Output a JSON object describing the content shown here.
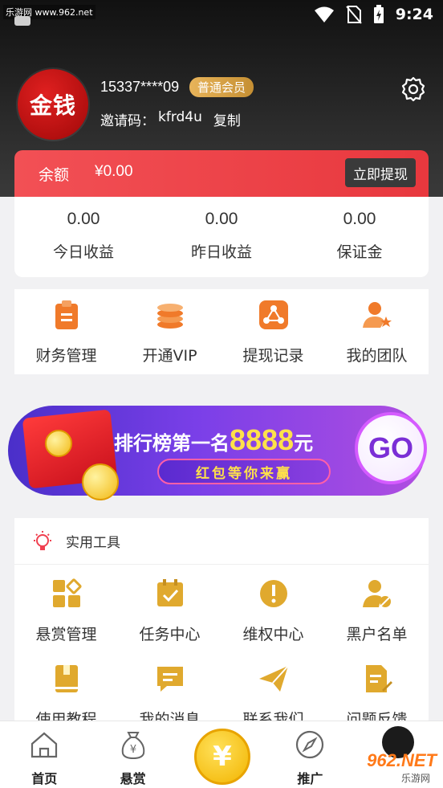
{
  "statusbar": {
    "watermark": "乐游网 www.962.net",
    "time": "9:24"
  },
  "profile": {
    "avatar_text": "金钱",
    "phone": "15337****09",
    "member_level": "普通会员",
    "invite_label": "邀请码：",
    "invite_code": "kfrd4u",
    "copy_label": "复制"
  },
  "balance": {
    "label": "余额",
    "value": "¥0.00",
    "withdraw_label": "立即提现"
  },
  "earnings": [
    {
      "value": "0.00",
      "label": "今日收益"
    },
    {
      "value": "0.00",
      "label": "昨日收益"
    },
    {
      "value": "0.00",
      "label": "保证金"
    }
  ],
  "quick_menu": [
    {
      "label": "财务管理",
      "icon": "clipboard-icon"
    },
    {
      "label": "开通VIP",
      "icon": "coins-icon"
    },
    {
      "label": "提现记录",
      "icon": "share-icon"
    },
    {
      "label": "我的团队",
      "icon": "user-star-icon"
    }
  ],
  "banner": {
    "title": "排行榜第一名",
    "amount": "8888",
    "unit": "元",
    "subtitle": "红包等你来赢",
    "go": "GO"
  },
  "tools": {
    "title": "实用工具",
    "items": [
      {
        "label": "悬赏管理",
        "icon": "grid-icon"
      },
      {
        "label": "任务中心",
        "icon": "calendar-check-icon"
      },
      {
        "label": "维权中心",
        "icon": "alert-icon"
      },
      {
        "label": "黑户名单",
        "icon": "user-block-icon"
      },
      {
        "label": "使用教程",
        "icon": "book-icon"
      },
      {
        "label": "我的消息",
        "icon": "message-icon"
      },
      {
        "label": "联系我们",
        "icon": "send-icon"
      },
      {
        "label": "问题反馈",
        "icon": "edit-doc-icon"
      }
    ]
  },
  "bottom_nav": [
    {
      "label": "首页",
      "icon": "home-icon"
    },
    {
      "label": "悬赏",
      "icon": "money-bag-icon"
    },
    {
      "label": "",
      "icon": "yuan-coin-icon"
    },
    {
      "label": "推广",
      "icon": "compass-icon"
    }
  ],
  "corner_watermark": {
    "text": "962.NET",
    "sub": "乐游网"
  },
  "colors": {
    "accent_red": "#e8383e",
    "gold": "#f2b400",
    "icon_orange": "#f07a2a",
    "icon_gold": "#e0a92e"
  }
}
